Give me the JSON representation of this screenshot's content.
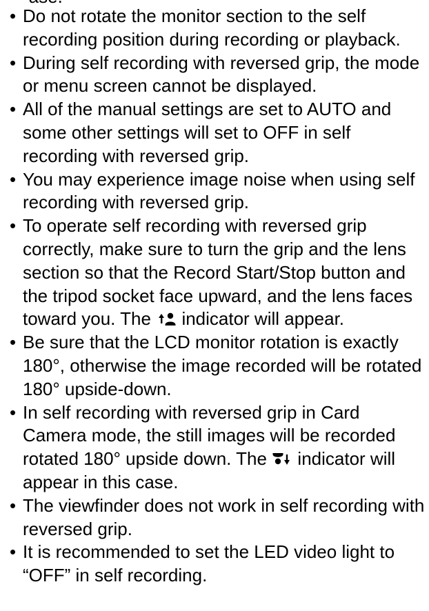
{
  "top_fragment": "-ase.",
  "notes": [
    "Do not rotate the monitor section to the self recording position during recording or playback.",
    "During self recording with reversed grip, the mode or menu screen cannot be displayed.",
    "All of the manual settings are set to AUTO and some other settings will set to OFF in self recording with reversed grip.",
    "You may experience image noise when using self recording with reversed grip."
  ],
  "note_grip_before_icon": "To operate self recording with reversed grip correctly, make sure to turn the grip and the lens section so that the Record Start/Stop button and the tripod socket face upward, and the lens faces toward you. The",
  "note_grip_after_icon": "indicator will appear.",
  "note_lcd": "Be sure that the LCD monitor rotation is exactly 180°, otherwise the image recorded will be rotated 180° upside-down.",
  "note_card_before_icon": "In self recording with reversed grip in Card Camera mode, the still images will be recorded rotated 180° upside down. The",
  "note_card_after_icon": "indicator will appear in this case.",
  "note_viewfinder": "The viewfinder does not work in self recording with reversed grip.",
  "note_led": "It is recommended to set the LED video light to “OFF” in self recording.",
  "bullet_glyph": "•",
  "icons": {
    "self_recording_indicator": "self-recording-person-up-arrow-icon",
    "upside_down_indicator": "upside-down-person-down-arrow-icon"
  }
}
